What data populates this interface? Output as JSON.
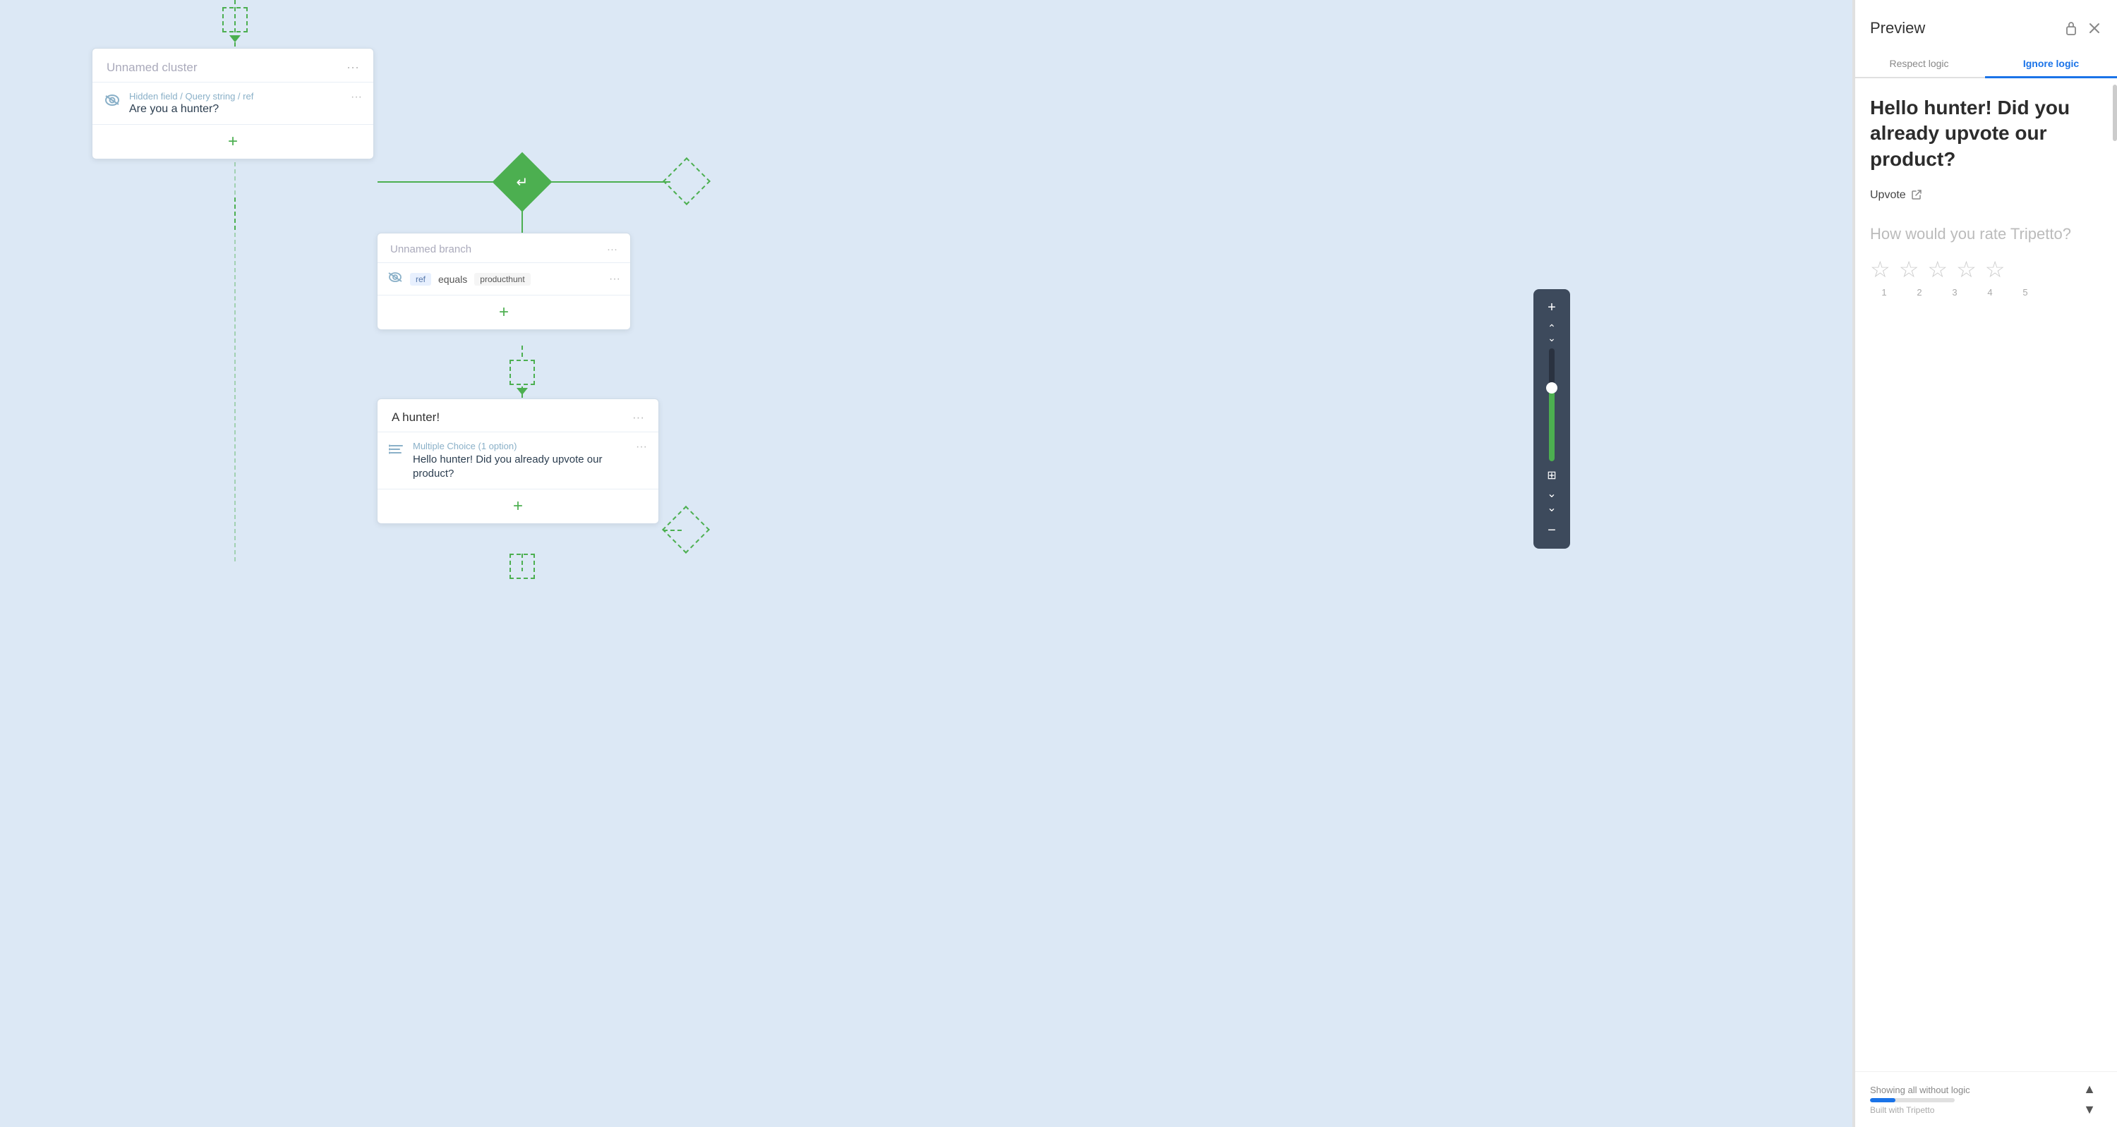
{
  "preview": {
    "title": "Preview",
    "lock_icon": "🔒",
    "close_icon": "✕",
    "tabs": [
      {
        "id": "respect",
        "label": "Respect logic",
        "active": false
      },
      {
        "id": "ignore",
        "label": "Ignore logic",
        "active": true
      }
    ],
    "question_title": "Hello hunter! Did you already upvote our product?",
    "upvote_label": "Upvote",
    "upvote_link": "↗",
    "rating_label": "How would you rate Tripetto?",
    "stars": [
      1,
      2,
      3,
      4,
      5
    ],
    "footer": {
      "showing_label": "Showing all without logic",
      "progress_percent": 30,
      "built_with": "Built with Tripetto"
    },
    "nav_up": "▲",
    "nav_down": "▼"
  },
  "canvas": {
    "cluster1": {
      "title": "Unnamed cluster",
      "item1": {
        "sublabel": "Hidden field / Query string / ref",
        "label": "Are you a hunter?"
      },
      "add_btn": "+"
    },
    "branch1": {
      "title": "Unnamed branch",
      "item1": {
        "tag": "ref",
        "equals": "equals",
        "value": "producthunt"
      },
      "add_btn": "+"
    },
    "section1": {
      "title": "A hunter!",
      "item1": {
        "sublabel": "Multiple Choice (1 option)",
        "label": "Hello hunter! Did you already upvote our product?"
      },
      "add_btn": "+"
    }
  },
  "zoom_controls": {
    "plus_label": "+",
    "minus_label": "−",
    "fit_label": "⊞",
    "arrows_up": "⌃",
    "arrows_down": "⌄"
  }
}
